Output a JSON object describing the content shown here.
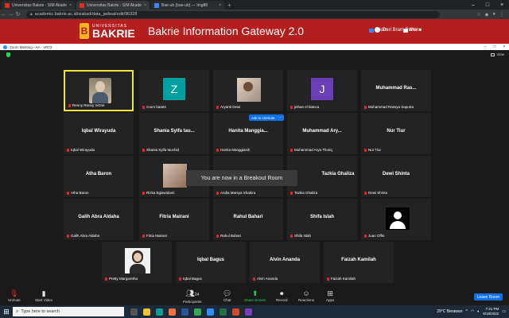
{
  "browser": {
    "tabs": [
      {
        "title": "Universitas Bakrie - SIM Akademi",
        "close": "×",
        "color": "#d93025"
      },
      {
        "title": "Universitas Bakrie - SIM Akademi",
        "close": "×",
        "color": "#d93025"
      },
      {
        "title": "Bae-ub (bae-ub) — Img88",
        "close": "×",
        "color": "#4285f4"
      }
    ],
    "new_tab": "+",
    "url": "academic.bakrie.ac.id/siakad/data_jadwal/edit/96328",
    "window_controls": [
      "–",
      "□",
      "×"
    ]
  },
  "header": {
    "logo_small": "UNIVERSITAS",
    "logo_big": "BAKRIE",
    "logo_letter": "B",
    "title": "Bakrie Information Gateway 2.0",
    "nav": [
      {
        "label": "Zoom",
        "color": "#2d8cff"
      },
      {
        "label": "Menu",
        "color": "#ffffff"
      }
    ],
    "user": "Deri Bram Putra"
  },
  "zoom": {
    "window_title": "Zoom Meeting - AA - VR72",
    "view_label": "View",
    "ask_unmute": "Ask to Unmute",
    "ask_more": "···",
    "breakout_msg": "You are now in a Breakout Room",
    "participants_count": "24",
    "leave": "Leave Room"
  },
  "tiles": [
    {
      "big": "",
      "name": "Renny Renny IvOne"
    },
    {
      "big": "",
      "name": "zoom baa04",
      "letter": "Z",
      "color": "#00a0a0"
    },
    {
      "big": "",
      "name": "Aryanti Dewi"
    },
    {
      "big": "",
      "name": "jeihan el bianca",
      "letter": "J",
      "color": "#6b3fb8"
    },
    {
      "big": "Muhammad Ras...",
      "name": "Muhammad Rassya Saputra"
    },
    {
      "big": "Iqbal Wirayuda",
      "name": "Iqbal Wirayuda"
    },
    {
      "big": "Shania Syifa tau...",
      "name": "Shania Syifa tauchid"
    },
    {
      "big": "Hanita Manggia...",
      "name": "Hanita Manggiasih"
    },
    {
      "big": "Muhammad Ary...",
      "name": "Muhammad Arya Thoriq"
    },
    {
      "big": "Nur Tiur",
      "name": "Nur Tiur"
    },
    {
      "big": "Atha Baron",
      "name": "Atha Baron"
    },
    {
      "big": "",
      "name": "Rizka Egiawidanti"
    },
    {
      "big": "",
      "name": "Andia Marsya Shabira"
    },
    {
      "big": "Tazkia Ghaliza",
      "name": "Tazkia Ghaliza"
    },
    {
      "big": "Dewi Shinta",
      "name": "Dewi Shinta"
    },
    {
      "big": "Galih Abra Aldaha",
      "name": "Galih Abra Aldaha"
    },
    {
      "big": "Fitria Mairani",
      "name": "Fitria Mairani"
    },
    {
      "big": "Rahul Bahari",
      "name": "Rahul Bahari"
    },
    {
      "big": "Shifa Islah",
      "name": "Shifa Islah"
    },
    {
      "big": "",
      "name": "Juan Offin"
    },
    {
      "big": "",
      "name": "Pretty Margaretha"
    },
    {
      "big": "Iqbal Bagus",
      "name": "Iqbal Bagus"
    },
    {
      "big": "Alvin Ananda",
      "name": "Alvin Ananda"
    },
    {
      "big": "Faizah Kamilah",
      "name": "Faizah Kamilah"
    }
  ],
  "toolbar": {
    "unmute": "Unmute",
    "start_video": "Start Video",
    "participants": "Participants",
    "chat": "Chat",
    "share": "Share Screen",
    "record": "Record",
    "reactions": "Reactions",
    "apps": "Apps"
  },
  "taskbar": {
    "search_placeholder": "Type here to search",
    "weather": "29°C  Berawan",
    "time": "7:21 PM",
    "date": "9/18/2022"
  }
}
